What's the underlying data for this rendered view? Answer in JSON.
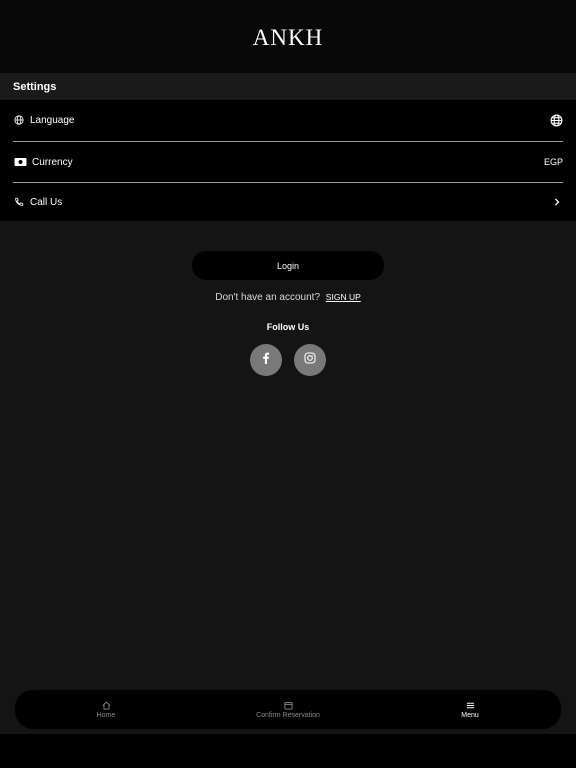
{
  "header": {
    "logo_text": "ANKH"
  },
  "settings": {
    "title": "Settings",
    "items": [
      {
        "label": "Language",
        "icon": "globe-icon",
        "trailing_icon": "globe-icon"
      },
      {
        "label": "Currency",
        "icon": "money-icon",
        "value": "EGP"
      },
      {
        "label": "Call Us",
        "icon": "phone-icon",
        "trailing_icon": "chevron-right-icon"
      }
    ]
  },
  "auth": {
    "login_label": "Login",
    "no_account_text": "Don't have an account?",
    "signup_label": "SIGN UP"
  },
  "social": {
    "title": "Follow Us",
    "links": [
      {
        "icon": "facebook-icon"
      },
      {
        "icon": "instagram-icon"
      }
    ]
  },
  "nav": {
    "items": [
      {
        "label": "Home",
        "icon": "home-icon",
        "active": false
      },
      {
        "label": "Confirm Reservation",
        "icon": "calendar-icon",
        "active": false
      },
      {
        "label": "Menu",
        "icon": "menu-icon",
        "active": true
      }
    ]
  },
  "colors": {
    "background": "#141414",
    "surface": "#000000",
    "accent": "#ffffff",
    "social_bg": "#7b7878"
  }
}
